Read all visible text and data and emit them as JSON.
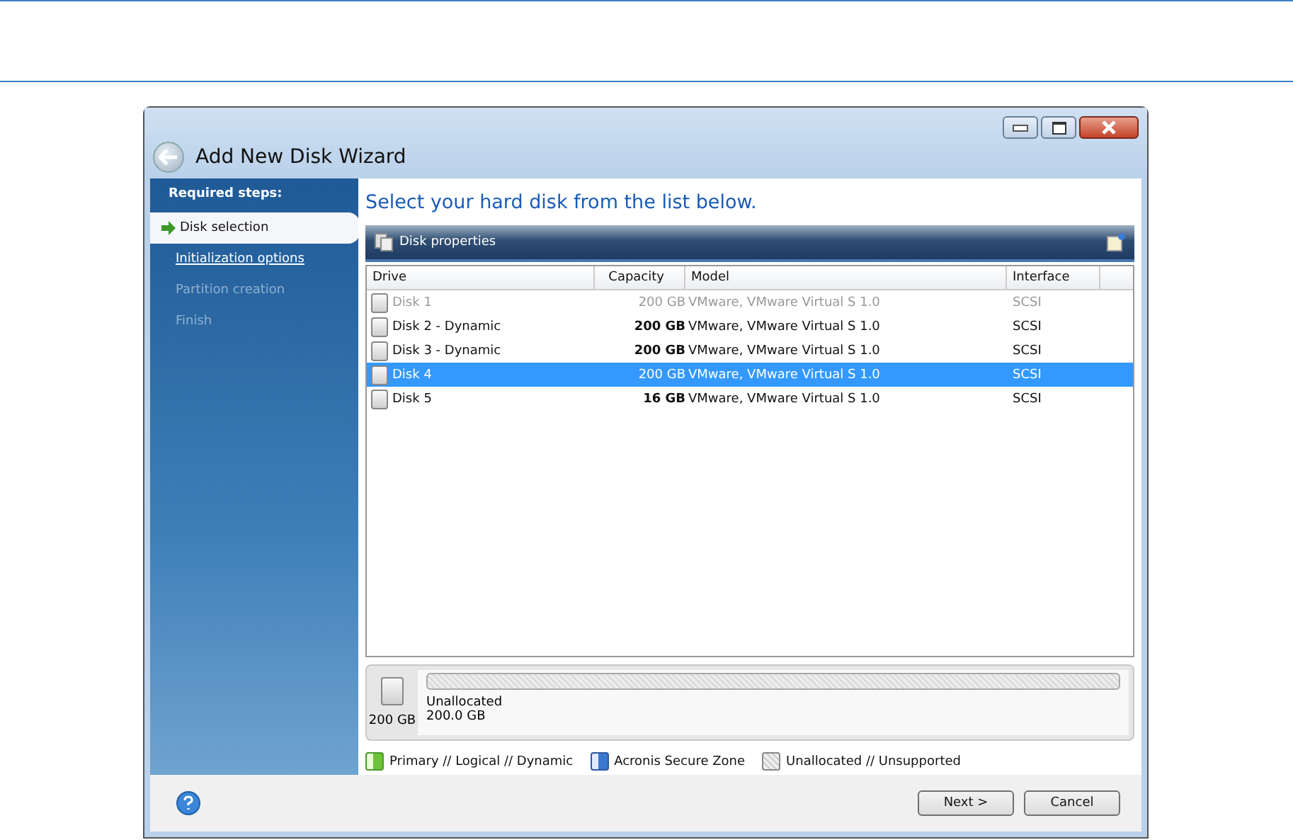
{
  "window": {
    "title": "Add New Disk Wizard"
  },
  "sidebar": {
    "heading": "Required steps:",
    "steps": [
      {
        "label": "Disk selection",
        "selected": true,
        "disabled": false
      },
      {
        "label": "Initialization options",
        "selected": false,
        "disabled": false
      },
      {
        "label": "Partition creation",
        "selected": false,
        "disabled": true
      },
      {
        "label": "Finish",
        "selected": false,
        "disabled": true
      }
    ]
  },
  "heading": "Select your hard disk from the list below.",
  "panel": {
    "title": "Disk properties"
  },
  "table": {
    "columns": [
      "Drive",
      "Capacity",
      "Model",
      "Interface"
    ],
    "rows": [
      {
        "drive": "Disk 1",
        "capacity": "200 GB",
        "model": "VMware, VMware Virtual S 1.0",
        "interface": "SCSI",
        "disabled": true,
        "selected": false
      },
      {
        "drive": "Disk 2 - Dynamic",
        "capacity": "200 GB",
        "model": "VMware, VMware Virtual S 1.0",
        "interface": "SCSI",
        "disabled": false,
        "selected": false
      },
      {
        "drive": "Disk 3 - Dynamic",
        "capacity": "200 GB",
        "model": "VMware, VMware Virtual S 1.0",
        "interface": "SCSI",
        "disabled": false,
        "selected": false
      },
      {
        "drive": "Disk 4",
        "capacity": "200 GB",
        "model": "VMware, VMware Virtual S 1.0",
        "interface": "SCSI",
        "disabled": false,
        "selected": true
      },
      {
        "drive": "Disk 5",
        "capacity": "16 GB",
        "model": "VMware, VMware Virtual S 1.0",
        "interface": "SCSI",
        "disabled": false,
        "selected": false
      }
    ]
  },
  "disk_map": {
    "size": "200 GB",
    "partition_label": "Unallocated",
    "partition_size": "200.0 GB"
  },
  "legend": [
    {
      "label": "Primary // Logical // Dynamic",
      "kind": "primary"
    },
    {
      "label": "Acronis Secure Zone",
      "kind": "secure"
    },
    {
      "label": "Unallocated // Unsupported",
      "kind": "unallocated"
    }
  ],
  "buttons": [
    "Next >",
    "Cancel"
  ]
}
